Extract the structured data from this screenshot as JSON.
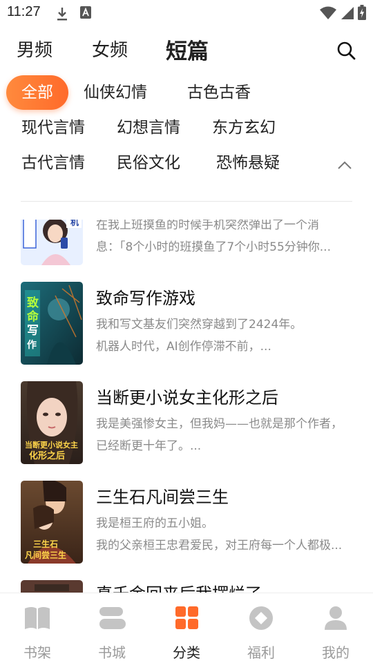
{
  "status_bar": {
    "time": "11:27"
  },
  "top_tabs": [
    {
      "label": "男频",
      "active": false
    },
    {
      "label": "女频",
      "active": false
    },
    {
      "label": "短篇",
      "active": true
    }
  ],
  "filters": {
    "rows": [
      [
        "全部",
        "仙侠幻情",
        "古色古香"
      ],
      [
        "现代言情",
        "幻想言情",
        "东方玄幻"
      ],
      [
        "古代言情",
        "民俗文化",
        "恐怖悬疑"
      ]
    ],
    "selected": "全部"
  },
  "books": [
    {
      "title": "",
      "desc1": "在我上班摸鱼的时候手机突然弹出了一个消",
      "desc2": "息：「8个小时的班摸鱼了7个小时55分钟你...",
      "cover_text": ""
    },
    {
      "title": "致命写作游戏",
      "desc1": "我和写文基友们突然穿越到了2424年。",
      "desc2": "机器人时代，AI创作停滞不前，...",
      "cover_text": "致命写作游戏"
    },
    {
      "title": "当断更小说女主化形之后",
      "desc1": "我是美强惨女主，但我妈——也就是那个作者，",
      "desc2": "已经断更十年了。...",
      "cover_text": "当断更小说女主化形之后"
    },
    {
      "title": "三生石凡间尝三生",
      "desc1": "我是桓王府的五小姐。",
      "desc2": "我的父亲桓王忠君爱民，对王府每一个人都极...",
      "cover_text": "三生石凡间尝三生"
    },
    {
      "title": "真千金回来后我摆烂了",
      "desc1": "",
      "desc2": "",
      "cover_text": ""
    }
  ],
  "bottom_nav": [
    {
      "label": "书架",
      "icon": "book-open-icon",
      "active": false
    },
    {
      "label": "书城",
      "icon": "bookstore-icon",
      "active": false
    },
    {
      "label": "分类",
      "icon": "category-grid-icon",
      "active": true
    },
    {
      "label": "福利",
      "icon": "welfare-diamond-icon",
      "active": false
    },
    {
      "label": "我的",
      "icon": "profile-icon",
      "active": false
    }
  ],
  "colors": {
    "accent": "#ff6a2a",
    "accent_light": "#ff8a3d",
    "inactive": "#c4c4c4"
  }
}
